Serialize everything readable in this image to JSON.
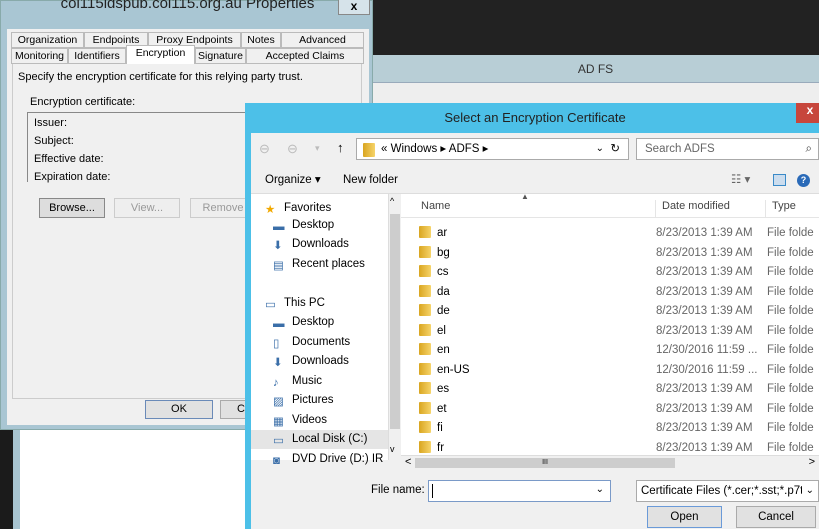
{
  "background": {
    "app_title": "AD FS"
  },
  "properties": {
    "title": "col115idspub.col115.org.au Properties",
    "close": "x",
    "tabs_row1": [
      "Organization",
      "Endpoints",
      "Proxy Endpoints",
      "Notes",
      "Advanced"
    ],
    "tabs_row2": [
      "Monitoring",
      "Identifiers",
      "Encryption",
      "Signature",
      "Accepted Claims"
    ],
    "selected_tab": "Encryption",
    "description": "Specify the encryption certificate for this relying party trust.",
    "cert_label": "Encryption certificate:",
    "fields": [
      "Issuer:",
      "Subject:",
      "Effective date:",
      "Expiration date:"
    ],
    "browse": "Browse...",
    "view": "View...",
    "remove": "Remove",
    "ok": "OK",
    "cancel": "C"
  },
  "dialog": {
    "title": "Select an Encryption Certificate",
    "close": "x",
    "address": "« Windows ▸ ADFS ▸",
    "search_placeholder": "Search ADFS",
    "organize": "Organize ▾",
    "new_folder": "New folder",
    "nav": [
      {
        "label": "Favorites",
        "icon": "star-icon"
      },
      {
        "label": "Desktop",
        "icon": "desktop-icon"
      },
      {
        "label": "Downloads",
        "icon": "downloads-icon"
      },
      {
        "label": "Recent places",
        "icon": "recent-places-icon"
      },
      {
        "label": "",
        "icon": ""
      },
      {
        "label": "This PC",
        "icon": "computer-icon"
      },
      {
        "label": "Desktop",
        "icon": "desktop-icon"
      },
      {
        "label": "Documents",
        "icon": "documents-icon"
      },
      {
        "label": "Downloads",
        "icon": "downloads-icon"
      },
      {
        "label": "Music",
        "icon": "music-icon"
      },
      {
        "label": "Pictures",
        "icon": "pictures-icon"
      },
      {
        "label": "Videos",
        "icon": "videos-icon"
      },
      {
        "label": "Local Disk (C:)",
        "icon": "drive-icon"
      },
      {
        "label": "DVD Drive (D:) IR",
        "icon": "dvd-icon"
      }
    ],
    "selected_nav": "Local Disk (C:)",
    "columns": [
      "Name",
      "Date modified",
      "Type"
    ],
    "rows": [
      [
        "ar",
        "8/23/2013 1:39 AM",
        "File folde"
      ],
      [
        "bg",
        "8/23/2013 1:39 AM",
        "File folde"
      ],
      [
        "cs",
        "8/23/2013 1:39 AM",
        "File folde"
      ],
      [
        "da",
        "8/23/2013 1:39 AM",
        "File folde"
      ],
      [
        "de",
        "8/23/2013 1:39 AM",
        "File folde"
      ],
      [
        "el",
        "8/23/2013 1:39 AM",
        "File folde"
      ],
      [
        "en",
        "12/30/2016 11:59 ...",
        "File folde"
      ],
      [
        "en-US",
        "12/30/2016 11:59 ...",
        "File folde"
      ],
      [
        "es",
        "8/23/2013 1:39 AM",
        "File folde"
      ],
      [
        "et",
        "8/23/2013 1:39 AM",
        "File folde"
      ],
      [
        "fi",
        "8/23/2013 1:39 AM",
        "File folde"
      ],
      [
        "fr",
        "8/23/2013 1:39 AM",
        "File folde"
      ]
    ],
    "file_name_label": "File name:",
    "file_name_value": "",
    "file_type": "Certificate Files (*.cer;*.sst;*.p7t",
    "open": "Open",
    "cancel": "Cancel",
    "accent": "#4cc0e8"
  }
}
